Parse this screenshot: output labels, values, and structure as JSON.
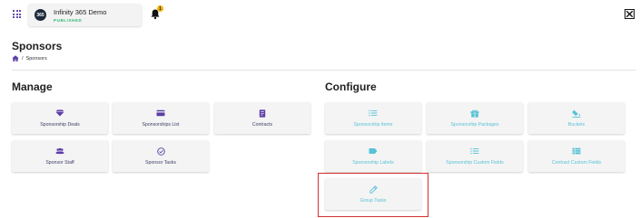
{
  "app": {
    "logo_text": "365",
    "name": "Infinity 365 Demo",
    "status": "PUBLISHED"
  },
  "notifications": {
    "count": "1"
  },
  "page": {
    "title": "Sponsors",
    "breadcrumb_current": "Sponsors",
    "breadcrumb_separator": "/"
  },
  "manage": {
    "title": "Manage",
    "tiles": [
      {
        "label": "Sponsorship Deals",
        "icon": "diamond-icon"
      },
      {
        "label": "Sponsorships List",
        "icon": "card-icon"
      },
      {
        "label": "Contracts",
        "icon": "contract-icon"
      },
      {
        "label": "Sponsor Staff",
        "icon": "staff-icon"
      },
      {
        "label": "Sponsor Tasks",
        "icon": "check-circle-icon"
      }
    ]
  },
  "configure": {
    "title": "Configure",
    "tiles": [
      {
        "label": "Sponsorship Items",
        "icon": "list-icon"
      },
      {
        "label": "Sponsorship Packages",
        "icon": "package-icon"
      },
      {
        "label": "Buckets",
        "icon": "bucket-icon"
      },
      {
        "label": "Sponsorship Labels",
        "icon": "label-icon"
      },
      {
        "label": "Sponsorship Custom Fields",
        "icon": "list-icon"
      },
      {
        "label": "Contract Custom Fields",
        "icon": "table-icon"
      },
      {
        "label": "Group Tasks",
        "icon": "pencil-icon"
      }
    ]
  },
  "colors": {
    "accent": "#5b3da6",
    "config_text": "#58c2d6",
    "published": "#2bb673",
    "highlight": "#d32f2f",
    "badge": "#f0b400"
  }
}
